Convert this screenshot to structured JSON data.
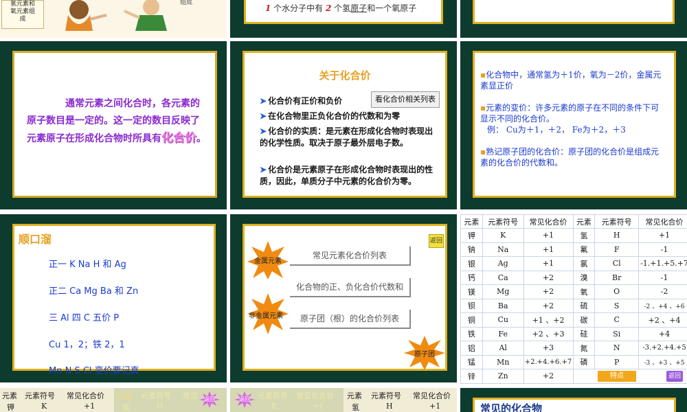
{
  "s1": {
    "label_lines": [
      "氢元素和",
      "氧元素组",
      "成"
    ],
    "right_label": "组成"
  },
  "s2": {
    "line_n1": "1",
    "line_a": " 个水分子中有 ",
    "line_n2": "2",
    "line_b": " 个氢",
    "line_c": "原子",
    "line_d": "和一个氧原子"
  },
  "s4": {
    "text_a": "通常元素之间化合时，各元素的原子数目是一定的。这一定的数目反映了元素原子在形成化合物时所具有",
    "text_b": "化合价",
    "text_c": "。"
  },
  "s5": {
    "title": "关于化合价",
    "button": "看化合价相关列表",
    "bullets": [
      "化合价有正价和负价",
      "在化合物里正负化合价的代数和为零",
      "化合价的实质：是元素在形成化合物时表现出的化学性质。取决于原子最外层电子数。",
      "化合价是元素原子在形成化合物时表现出的性质，因此，单质分子中元素的化合价为零。"
    ]
  },
  "s6": {
    "bullets": [
      "化合物中，通常氢为＋1价，氧为－2价，金属元素显正价",
      "元素的变价：许多元素的原子在不同的条件下可显示不同的化合价。",
      "例： Cu为＋1，＋2， Fe为＋2，＋3",
      "熟记原子团的化合价：原子团的化合价是组成元素的化合价的代数和。"
    ]
  },
  "s7": {
    "title": "顺口溜",
    "lines": [
      "正一 K Na H 和 Ag",
      "正二 Ca Mg Ba 和 Zn",
      "三 Al  四 C  五价 P",
      "Cu 1，2；铁 2，1",
      "Mn N S Cl 变价要记真"
    ]
  },
  "s8": {
    "star1": "金属元素",
    "star2": "非金属元素",
    "star3": "原子团",
    "back": "返回",
    "menu": [
      "常见元素化合价列表",
      "化合物的正、负化合价代数和",
      "原子团（根）的化合价列表"
    ]
  },
  "s9": {
    "headers": [
      "元素",
      "元素符号",
      "常见化合价",
      "元素",
      "元素符号",
      "常见化合价"
    ],
    "rows": [
      [
        "钾",
        "K",
        "+1",
        "氢",
        "H",
        "+1"
      ],
      [
        "钠",
        "Na",
        "+1",
        "氟",
        "F",
        "-1"
      ],
      [
        "银",
        "Ag",
        "+1",
        "氯",
        "Cl",
        "-1.+1.+5.+7"
      ],
      [
        "钙",
        "Ca",
        "+2",
        "溴",
        "Br",
        "-1"
      ],
      [
        "镁",
        "Mg",
        "+2",
        "氧",
        "O",
        "-2"
      ],
      [
        "钡",
        "Ba",
        "+2",
        "硫",
        "S",
        "-2 、+4 、+6"
      ],
      [
        "铜",
        "Cu",
        "+1 、+2",
        "碳",
        "C",
        "+2 、+4"
      ],
      [
        "铁",
        "Fe",
        "+2 、+3",
        "硅",
        "Si",
        "+4"
      ],
      [
        "铝",
        "Al",
        "+3",
        "氮",
        "N",
        "-3.+2.+4.+5"
      ],
      [
        "锰",
        "Mn",
        "+2.+4.+6.+7",
        "磷",
        "P",
        "-3 、+3 、+5"
      ],
      [
        "锌",
        "Zn",
        "+2",
        "",
        "",
        ""
      ]
    ],
    "feature": "特点",
    "back": "返回"
  },
  "s10": {
    "headers": [
      "元素",
      "元素符号",
      "常见化合价"
    ],
    "row": [
      "钾",
      "K",
      "+1"
    ],
    "right_headers": [
      "元素",
      "元素符号",
      "常见"
    ],
    "right_row": [
      "氢",
      "H"
    ],
    "back": "返回"
  },
  "s11": {
    "back": "返回",
    "headers": [
      "元素符号",
      "常见化合价",
      "元素",
      "元素符号",
      "常见化合价"
    ],
    "row": [
      "K",
      "+1",
      "氢",
      "H",
      "+1"
    ]
  },
  "s12": {
    "title": "常见的化合物"
  }
}
